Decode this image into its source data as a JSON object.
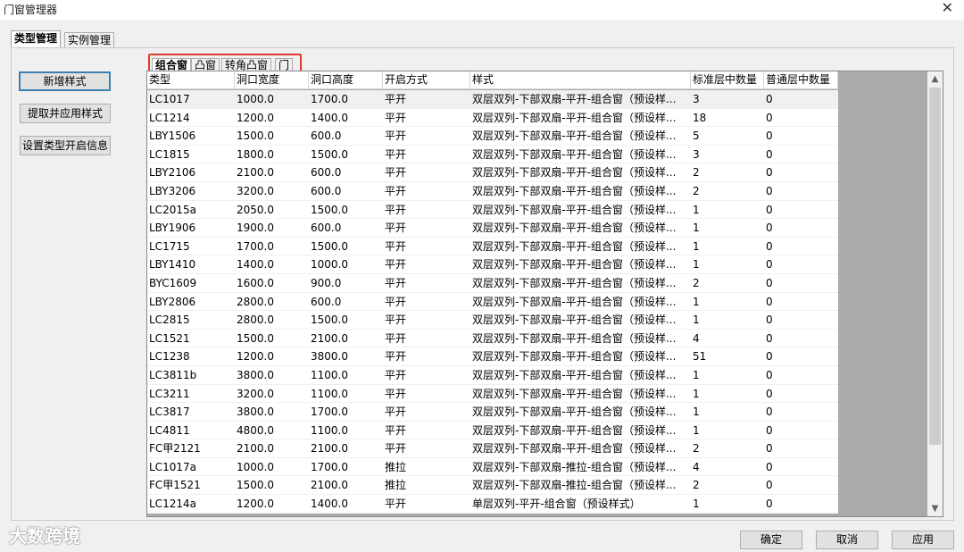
{
  "window": {
    "title": "门窗管理器",
    "close_glyph": "✕"
  },
  "tabs": [
    {
      "label": "类型管理",
      "active": true
    },
    {
      "label": "实例管理",
      "active": false
    }
  ],
  "left_buttons": [
    {
      "label": "新增样式"
    },
    {
      "label": "提取并应用样式"
    },
    {
      "label": "设置类型开启信息"
    }
  ],
  "sub_tabs": [
    {
      "label": "组合窗",
      "active": true
    },
    {
      "label": "凸窗",
      "active": false
    },
    {
      "label": "转角凸窗",
      "active": false
    },
    {
      "label": "门",
      "active": false
    }
  ],
  "table": {
    "columns": [
      "类型",
      "洞口宽度",
      "洞口高度",
      "开启方式",
      "样式",
      "标准层中数量",
      "普通层中数量"
    ],
    "rows": [
      [
        "LC1017",
        "1000.0",
        "1700.0",
        "平开",
        "双层双列-下部双扇-平开-组合窗（预设样...",
        "3",
        "0"
      ],
      [
        "LC1214",
        "1200.0",
        "1400.0",
        "平开",
        "双层双列-下部双扇-平开-组合窗（预设样...",
        "18",
        "0"
      ],
      [
        "LBY1506",
        "1500.0",
        "600.0",
        "平开",
        "双层双列-下部双扇-平开-组合窗（预设样...",
        "5",
        "0"
      ],
      [
        "LC1815",
        "1800.0",
        "1500.0",
        "平开",
        "双层双列-下部双扇-平开-组合窗（预设样...",
        "3",
        "0"
      ],
      [
        "LBY2106",
        "2100.0",
        "600.0",
        "平开",
        "双层双列-下部双扇-平开-组合窗（预设样...",
        "2",
        "0"
      ],
      [
        "LBY3206",
        "3200.0",
        "600.0",
        "平开",
        "双层双列-下部双扇-平开-组合窗（预设样...",
        "2",
        "0"
      ],
      [
        "LC2015a",
        "2050.0",
        "1500.0",
        "平开",
        "双层双列-下部双扇-平开-组合窗（预设样...",
        "1",
        "0"
      ],
      [
        "LBY1906",
        "1900.0",
        "600.0",
        "平开",
        "双层双列-下部双扇-平开-组合窗（预设样...",
        "1",
        "0"
      ],
      [
        "LC1715",
        "1700.0",
        "1500.0",
        "平开",
        "双层双列-下部双扇-平开-组合窗（预设样...",
        "1",
        "0"
      ],
      [
        "LBY1410",
        "1400.0",
        "1000.0",
        "平开",
        "双层双列-下部双扇-平开-组合窗（预设样...",
        "1",
        "0"
      ],
      [
        "BYC1609",
        "1600.0",
        "900.0",
        "平开",
        "双层双列-下部双扇-平开-组合窗（预设样...",
        "2",
        "0"
      ],
      [
        "LBY2806",
        "2800.0",
        "600.0",
        "平开",
        "双层双列-下部双扇-平开-组合窗（预设样...",
        "1",
        "0"
      ],
      [
        "LC2815",
        "2800.0",
        "1500.0",
        "平开",
        "双层双列-下部双扇-平开-组合窗（预设样...",
        "1",
        "0"
      ],
      [
        "LC1521",
        "1500.0",
        "2100.0",
        "平开",
        "双层双列-下部双扇-平开-组合窗（预设样...",
        "4",
        "0"
      ],
      [
        "LC1238",
        "1200.0",
        "3800.0",
        "平开",
        "双层双列-下部双扇-平开-组合窗（预设样...",
        "51",
        "0"
      ],
      [
        "LC3811b",
        "3800.0",
        "1100.0",
        "平开",
        "双层双列-下部双扇-平开-组合窗（预设样...",
        "1",
        "0"
      ],
      [
        "LC3211",
        "3200.0",
        "1100.0",
        "平开",
        "双层双列-下部双扇-平开-组合窗（预设样...",
        "1",
        "0"
      ],
      [
        "LC3817",
        "3800.0",
        "1700.0",
        "平开",
        "双层双列-下部双扇-平开-组合窗（预设样...",
        "1",
        "0"
      ],
      [
        "LC4811",
        "4800.0",
        "1100.0",
        "平开",
        "双层双列-下部双扇-平开-组合窗（预设样...",
        "1",
        "0"
      ],
      [
        "FC甲2121",
        "2100.0",
        "2100.0",
        "平开",
        "双层双列-下部双扇-平开-组合窗（预设样...",
        "2",
        "0"
      ],
      [
        "LC1017a",
        "1000.0",
        "1700.0",
        "推拉",
        "双层双列-下部双扇-推拉-组合窗（预设样...",
        "4",
        "0"
      ],
      [
        "FC甲1521",
        "1500.0",
        "2100.0",
        "推拉",
        "双层双列-下部双扇-推拉-组合窗（预设样...",
        "2",
        "0"
      ],
      [
        "LC1214a",
        "1200.0",
        "1400.0",
        "平开",
        "单层双列-平开-组合窗（预设样式）",
        "1",
        "0"
      ]
    ]
  },
  "scrollbar": {
    "up_glyph": "▲",
    "down_glyph": "▼"
  },
  "footer_buttons": [
    {
      "label": "确定"
    },
    {
      "label": "取消"
    },
    {
      "label": "应用"
    }
  ],
  "watermark": {
    "text": "大数跨境"
  }
}
